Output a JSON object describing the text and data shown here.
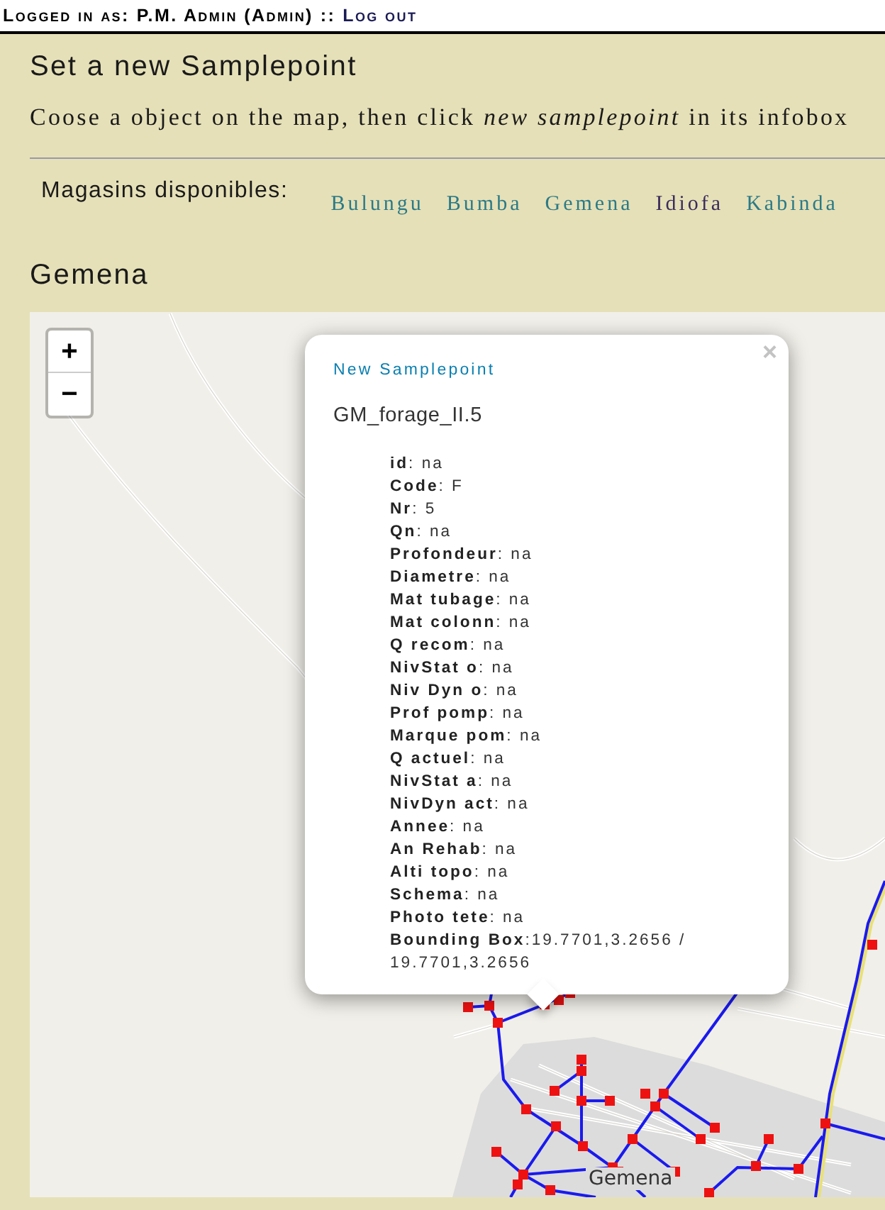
{
  "login_bar": {
    "prefix": "Logged in as:",
    "user": "P.M. Admin (Admin)",
    "separator": "::",
    "logout": "Log out"
  },
  "title": "Set a new Samplepoint",
  "instruction": "Coose a object on the map, then click *new samplepoint* in its infobox",
  "stores": {
    "label": "Magasins disponibles:",
    "links": [
      {
        "label": "Bulungu",
        "color": "#2b7a86"
      },
      {
        "label": "Bumba",
        "color": "#2b7a86"
      },
      {
        "label": "Gemena",
        "color": "#2b7a86"
      },
      {
        "label": "Idiofa",
        "color": "#3b2d5c"
      },
      {
        "label": "Kabinda",
        "color": "#2b7a86"
      }
    ]
  },
  "section_title": "Gemena",
  "map": {
    "zoom_in": "+",
    "zoom_out": "−",
    "place_label": "Gemena",
    "popup": {
      "link": "New Samplepoint",
      "close": "×",
      "heading": "GM_forage_II.5",
      "fields": [
        "**id**: na",
        "**Code**: F",
        "**Nr**: 5",
        "**Qn**: na",
        "**Profondeur**: na",
        "**Diametre**: na",
        "**Mat tubage**: na",
        "**Mat colonn**: na",
        "**Q recom**: na",
        "**NivStat o**: na",
        "**Niv Dyn o**: na",
        "**Prof pomp**: na",
        "**Marque pom**: na",
        "**Q actuel**: na",
        "**NivStat a**: na",
        "**NivDyn act**: na",
        "**Annee**: na",
        "**An Rehab**: na",
        "**Alti topo**: na",
        "**Schema**: na",
        "**Photo tete**: na",
        "**Bounding Box**:19.7701,3.2656 / 19.7701,3.2656"
      ]
    }
  }
}
